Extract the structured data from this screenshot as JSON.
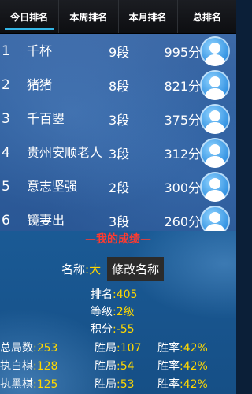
{
  "tabs": [
    {
      "label": "今日排名"
    },
    {
      "label": "本周排名"
    },
    {
      "label": "本月排名"
    },
    {
      "label": "总排名"
    }
  ],
  "rankings": [
    {
      "rank": "1",
      "name": "千杯",
      "level": "9段",
      "score": "995分"
    },
    {
      "rank": "2",
      "name": "猪猪",
      "level": "8段",
      "score": "821分"
    },
    {
      "rank": "3",
      "name": "千百曌",
      "level": "3段",
      "score": "375分"
    },
    {
      "rank": "4",
      "name": "贵州安顺老人",
      "level": "3段",
      "score": "312分"
    },
    {
      "rank": "5",
      "name": "意志坚强",
      "level": "2段",
      "score": "300分"
    },
    {
      "rank": "6",
      "name": "镜妻出",
      "level": "3段",
      "score": "260分"
    }
  ],
  "my_results": {
    "title": "—我的成绩—",
    "name_label": "名称",
    "name_value": ":大",
    "rename_button": "修改名称",
    "rank_label": "排名",
    "rank_value": ":405",
    "grade_label": "等级",
    "grade_value": ":2级",
    "points_label": "积分",
    "points_value": ":-55",
    "total_label": "总局数",
    "total_value": ":253",
    "total_win_label": "胜局",
    "total_win_value": ":107",
    "total_rate_label": "胜率",
    "total_rate_value": ":42%",
    "white_label": "执白棋",
    "white_value": ":128",
    "white_win_label": "胜局",
    "white_win_value": ":54",
    "white_rate_label": "胜率",
    "white_rate_value": ":42%",
    "black_label": "执黑棋",
    "black_value": ":125",
    "black_win_label": "胜局",
    "black_win_value": ":53",
    "black_rate_label": "胜率",
    "black_rate_value": ":42%"
  },
  "colors": {
    "tab_indicator": "#33b5e5",
    "title_red": "#ff3b2f",
    "value_yellow": "#ffd800"
  }
}
